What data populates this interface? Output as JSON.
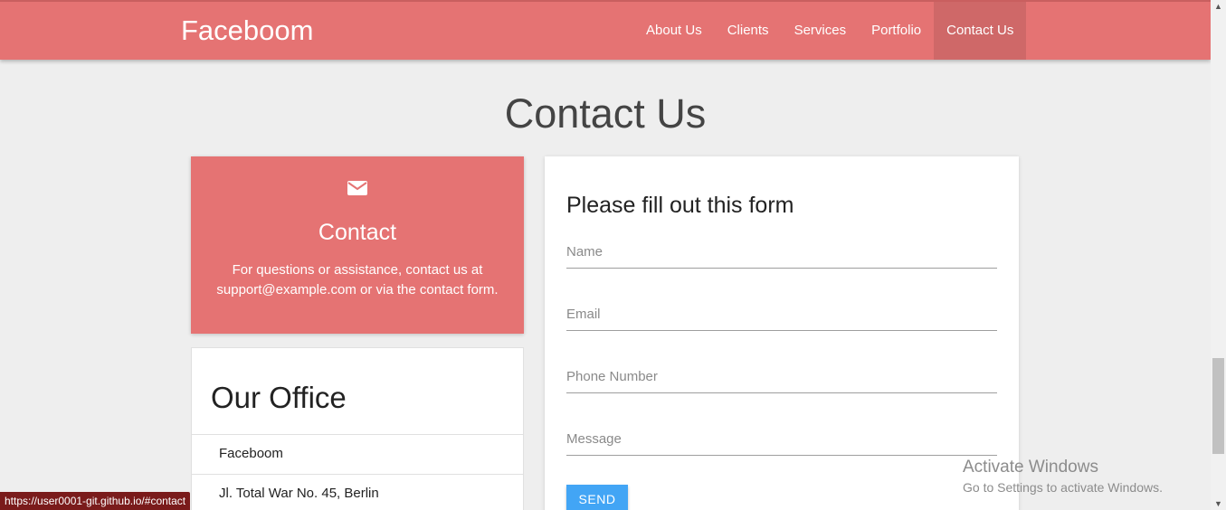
{
  "navbar": {
    "brand": "Faceboom",
    "links": [
      "About Us",
      "Clients",
      "Services",
      "Portfolio",
      "Contact Us"
    ],
    "active": "Contact Us",
    "color": "#e57373"
  },
  "page": {
    "title": "Contact Us"
  },
  "contact_card": {
    "icon": "mail-icon",
    "title": "Contact",
    "text": "For questions or assistance, contact us at support@example.com or via the contact form."
  },
  "office": {
    "title": "Our Office",
    "items": [
      "Faceboom",
      "Jl. Total War No. 45, Berlin"
    ]
  },
  "form": {
    "title": "Please fill out this form",
    "name_placeholder": "Name",
    "email_placeholder": "Email",
    "phone_placeholder": "Phone Number",
    "message_placeholder": "Message",
    "send_label": "SEND",
    "button_color": "#42a5f5"
  },
  "watermark": {
    "title": "Activate Windows",
    "subtitle": "Go to Settings to activate Windows."
  },
  "status_bar": {
    "url": "https://user0001-git.github.io/#contact"
  }
}
